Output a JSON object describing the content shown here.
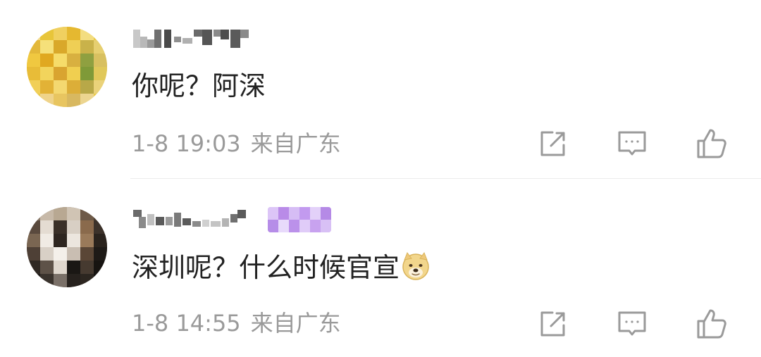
{
  "comments": [
    {
      "content": "你呢？阿深",
      "time": "1-8 19:03",
      "location": "来自广东",
      "avatar_icon": "pixelated-flower-avatar",
      "username_state": "pixelated-redacted"
    },
    {
      "content": "深圳呢？什么时候官宣",
      "time": "1-8 14:55",
      "location": "来自广东",
      "avatar_icon": "pixelated-cat-avatar",
      "username_state": "pixelated-redacted",
      "has_vip_badge": true,
      "emoji": "doge-emoji"
    }
  ],
  "icons": {
    "share": "share-icon",
    "reply": "comment-icon",
    "like": "thumbs-up-icon"
  },
  "colors": {
    "text": "#222222",
    "meta": "#9a9a9a",
    "icon": "#9a9a9a",
    "vip_badge": "#c9a5f0"
  }
}
